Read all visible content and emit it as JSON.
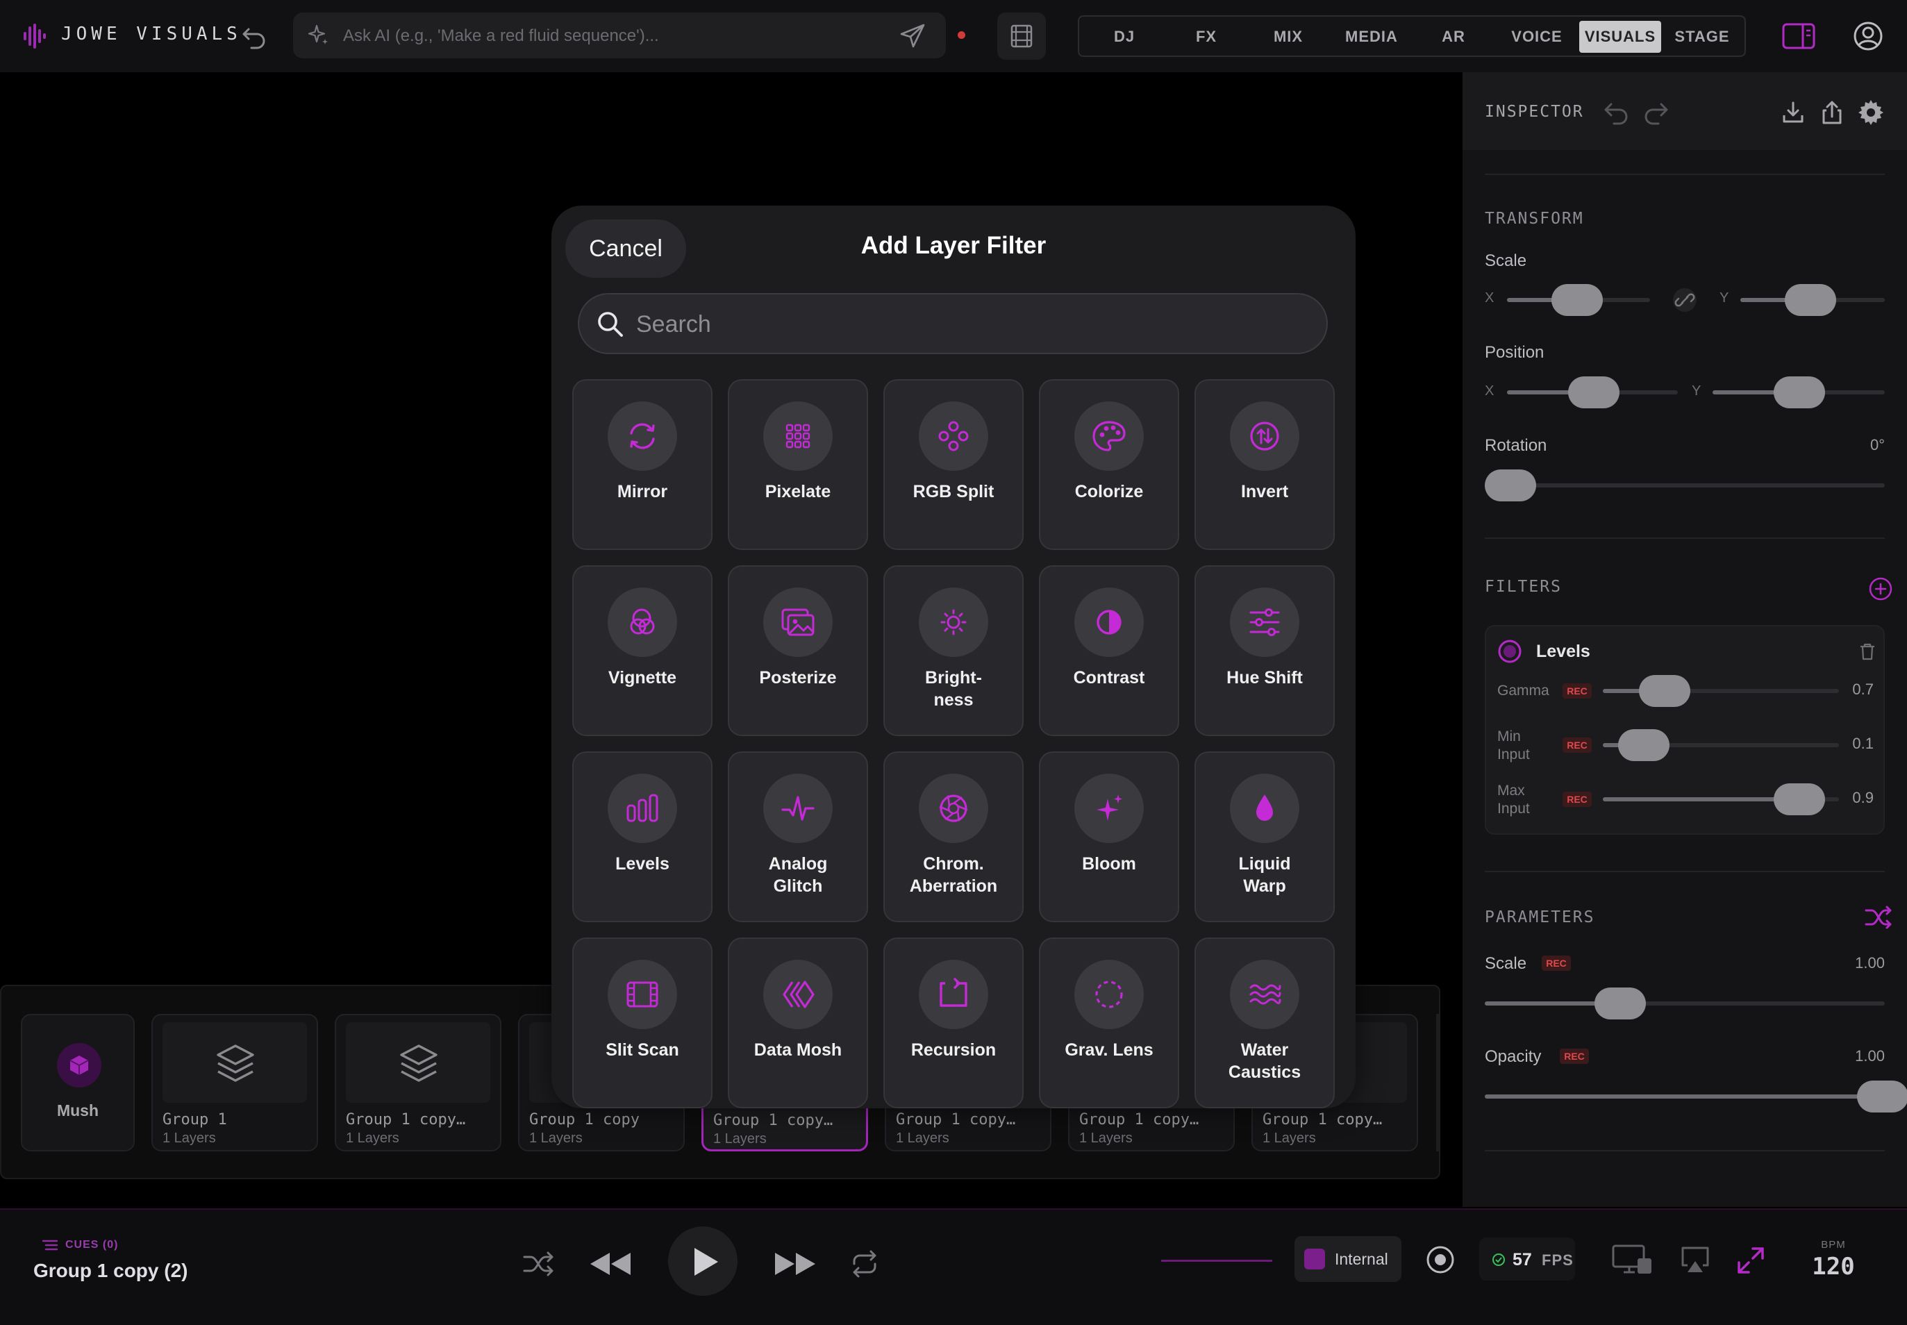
{
  "app": {
    "title": "JOWE VISUALS"
  },
  "ai_input": {
    "placeholder": "Ask AI (e.g., 'Make a red fluid sequence')..."
  },
  "modes": [
    {
      "label": "DJ"
    },
    {
      "label": "FX"
    },
    {
      "label": "MIX"
    },
    {
      "label": "MEDIA"
    },
    {
      "label": "AR"
    },
    {
      "label": "VOICE"
    },
    {
      "label": "VISUALS",
      "active": true
    },
    {
      "label": "STAGE"
    }
  ],
  "inspector": {
    "title": "INSPECTOR",
    "transform": {
      "title": "TRANSFORM",
      "scale_label": "Scale",
      "x_label": "X",
      "y_label": "Y",
      "position_label": "Position",
      "rotation_label": "Rotation",
      "rotation_value": "0°"
    },
    "filters": {
      "title": "FILTERS",
      "active_filter": "Levels",
      "rec_label": "REC",
      "params": [
        {
          "label": "Gamma",
          "value": "0.7",
          "level": 0.26
        },
        {
          "label": "Min\nInput",
          "value": "0.1",
          "level": 0.17
        },
        {
          "label": "Max\nInput",
          "value": "0.9",
          "level": 0.83
        }
      ]
    },
    "parameters": {
      "title": "PARAMETERS",
      "scale_label": "Scale",
      "scale_value": "1.00",
      "opacity_label": "Opacity",
      "opacity_value": "1.00"
    }
  },
  "layers": [
    {
      "name": "Mush",
      "sub": ""
    },
    {
      "name": "Group 1",
      "sub": "1 Layers"
    },
    {
      "name": "Group 1 copy…",
      "sub": "1 Layers"
    },
    {
      "name": "Group 1 copy",
      "sub": "1 Layers"
    },
    {
      "name": "Group 1 copy…",
      "sub": "1 Layers",
      "selected": true
    },
    {
      "name": "Group 1 copy…",
      "sub": "1 Layers"
    },
    {
      "name": "Group 1 copy…",
      "sub": "1 Layers"
    },
    {
      "name": "Group 1 copy…",
      "sub": "1 Layers"
    }
  ],
  "transport": {
    "cues_label": "CUES (0)",
    "current_cue": "Group 1 copy (2)",
    "clock_source": "Internal",
    "fps_value": "57",
    "fps_label": "FPS",
    "bpm_label": "BPM",
    "bpm_value": "120"
  },
  "modal": {
    "cancel_label": "Cancel",
    "title": "Add Layer Filter",
    "search_placeholder": "Search",
    "filters": [
      {
        "label": "Mirror",
        "icon": "mirror-icon"
      },
      {
        "label": "Pixelate",
        "icon": "grid-icon"
      },
      {
        "label": "RGB Split",
        "icon": "rgb-split-icon"
      },
      {
        "label": "Colorize",
        "icon": "palette-icon"
      },
      {
        "label": "Invert",
        "icon": "invert-icon"
      },
      {
        "label": "Vignette",
        "icon": "vignette-icon"
      },
      {
        "label": "Posterize",
        "icon": "posterize-icon"
      },
      {
        "label": "Bright-\nness",
        "icon": "sun-icon"
      },
      {
        "label": "Contrast",
        "icon": "contrast-icon"
      },
      {
        "label": "Hue Shift",
        "icon": "sliders-icon"
      },
      {
        "label": "Levels",
        "icon": "levels-icon"
      },
      {
        "label": "Analog\nGlitch",
        "icon": "pulse-icon"
      },
      {
        "label": "Chrom.\nAberration",
        "icon": "aperture-icon"
      },
      {
        "label": "Bloom",
        "icon": "sparkle-icon"
      },
      {
        "label": "Liquid\nWarp",
        "icon": "drop-icon"
      },
      {
        "label": "Slit Scan",
        "icon": "film-icon"
      },
      {
        "label": "Data Mosh",
        "icon": "datamosh-icon"
      },
      {
        "label": "Recursion",
        "icon": "recursion-icon"
      },
      {
        "label": "Grav. Lens",
        "icon": "lens-icon"
      },
      {
        "label": "Water\nCaustics",
        "icon": "waves-icon"
      }
    ]
  },
  "colors": {
    "accent": "#b829c8",
    "rec": "#e0484c",
    "ok": "#3cc05a"
  }
}
